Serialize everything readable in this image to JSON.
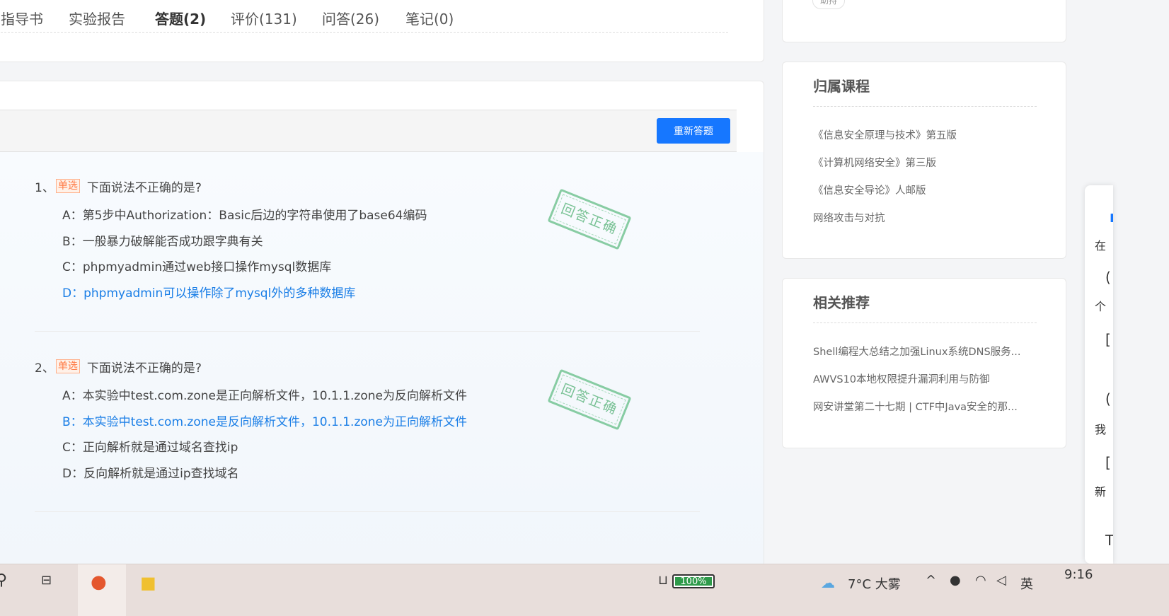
{
  "tabs": [
    {
      "label": "指导书",
      "active": false
    },
    {
      "label": "实验报告",
      "active": false
    },
    {
      "label": "答题(2)",
      "active": true
    },
    {
      "label": "评价(131)",
      "active": false
    },
    {
      "label": "问答(26)",
      "active": false
    },
    {
      "label": "笔记(0)",
      "active": false
    }
  ],
  "quiz": {
    "redo_label": "重新答题",
    "stamp_text": "回答正确",
    "questions": [
      {
        "number": "1、",
        "type": "单选",
        "title": "下面说法不正确的是?",
        "options": [
          {
            "text": "A：第5步中Authorization：Basic后边的字符串使用了base64编码",
            "correct": false
          },
          {
            "text": "B：一般暴力破解能否成功跟字典有关",
            "correct": false
          },
          {
            "text": "C：phpmyadmin通过web接口操作mysql数据库",
            "correct": false
          },
          {
            "text": "D：phpmyadmin可以操作除了mysql外的多种数据库",
            "correct": true
          }
        ]
      },
      {
        "number": "2、",
        "type": "单选",
        "title": "下面说法不正确的是?",
        "options": [
          {
            "text": "A：本实验中test.com.zone是正向解析文件，10.1.1.zone为反向解析文件",
            "correct": false
          },
          {
            "text": "B：本实验中test.com.zone是反向解析文件，10.1.1.zone为正向解析文件",
            "correct": true
          },
          {
            "text": "C：正向解析就是通过域名查找ip",
            "correct": false
          },
          {
            "text": "D：反向解析就是通过ip查找域名",
            "correct": false
          }
        ]
      }
    ]
  },
  "sidebar": {
    "top_tag": "助持",
    "course": {
      "title": "归属课程",
      "items": [
        "《信息安全原理与技术》第五版",
        "《计算机网络安全》第三版",
        "《信息安全导论》人邮版",
        "网络攻击与对抗"
      ]
    },
    "recommend": {
      "title": "相关推荐",
      "items": [
        "Shell编程大总结之加强Linux系统DNS服务...",
        "AWVS10本地权限提升漏洞利用与防御",
        "网安讲堂第二十七期 | CTF中Java安全的那..."
      ]
    }
  },
  "float_panel": {
    "items": [
      "在",
      "个",
      "我",
      "新"
    ]
  },
  "taskbar": {
    "battery": "100%",
    "weather": "7°C 大雾",
    "ime": "英",
    "time": "9:16"
  }
}
